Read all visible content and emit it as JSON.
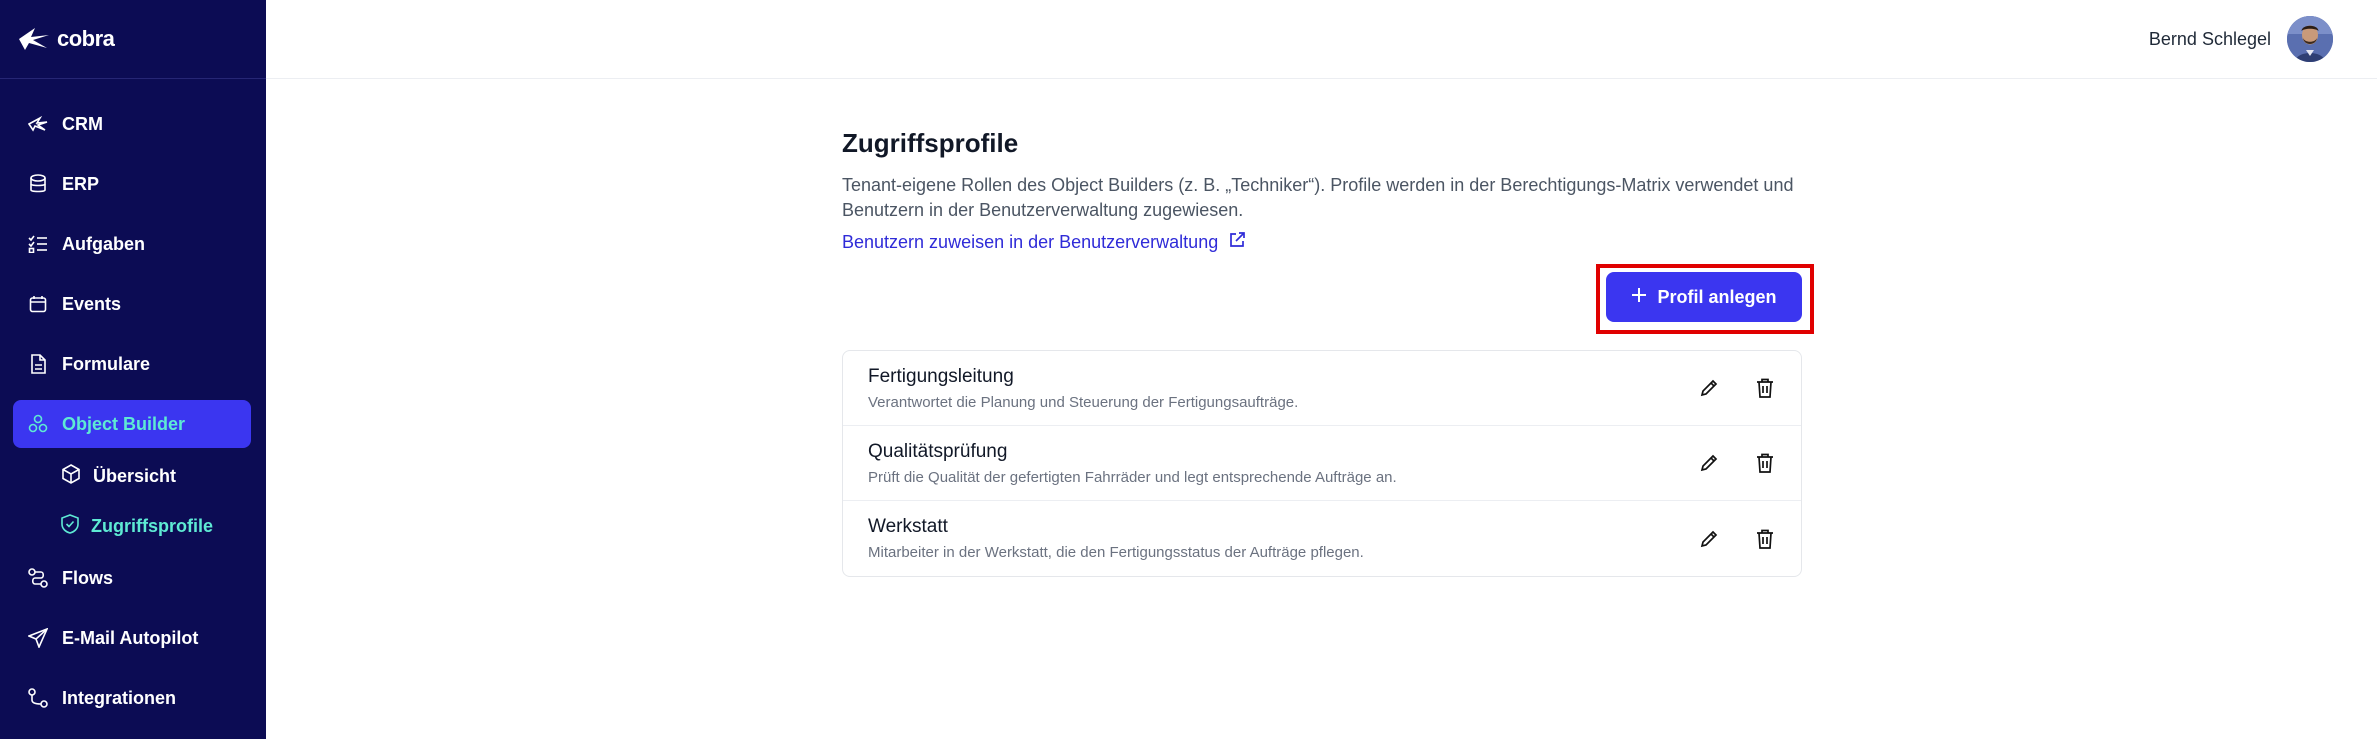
{
  "app": {
    "logo_text": "cobra"
  },
  "sidebar": {
    "items": [
      {
        "label": "CRM",
        "icon": "crm-icon"
      },
      {
        "label": "ERP",
        "icon": "database-icon"
      },
      {
        "label": "Aufgaben",
        "icon": "checklist-icon"
      },
      {
        "label": "Events",
        "icon": "calendar-icon"
      },
      {
        "label": "Formulare",
        "icon": "document-icon"
      },
      {
        "label": "Object Builder",
        "icon": "object-builder-icon",
        "active": true
      },
      {
        "label": "Flows",
        "icon": "flow-icon"
      },
      {
        "label": "E-Mail Autopilot",
        "icon": "send-icon"
      },
      {
        "label": "Integrationen",
        "icon": "integration-icon"
      }
    ],
    "sub_items": [
      {
        "label": "Übersicht",
        "icon": "cube-icon"
      },
      {
        "label": "Zugriffsprofile",
        "icon": "shield-icon",
        "active": true
      }
    ]
  },
  "header": {
    "user_name": "Bernd Schlegel"
  },
  "main": {
    "title": "Zugriffsprofile",
    "description": "Tenant-eigene Rollen des Object Builders (z. B. „Techniker“). Profile werden in der Berechtigungs-Matrix verwendet und Benutzern in der Benutzerverwaltung zugewiesen.",
    "link_text": "Benutzern zuweisen in der Benutzerverwaltung",
    "create_button": "Profil anlegen",
    "profiles": [
      {
        "name": "Fertigungsleitung",
        "description": "Verantwortet die Planung und Steuerung der Fertigungsaufträge."
      },
      {
        "name": "Qualitätsprüfung",
        "description": "Prüft die Qualität der gefertigten Fahrräder und legt entsprechende Aufträge an."
      },
      {
        "name": "Werkstatt",
        "description": "Mitarbeiter in der Werkstatt, die den Fertigungsstatus der Aufträge pflegen."
      }
    ]
  },
  "colors": {
    "sidebar_bg": "#0c0c54",
    "accent": "#3b36f0",
    "active_text": "#5eead4",
    "highlight": "#e00000"
  }
}
